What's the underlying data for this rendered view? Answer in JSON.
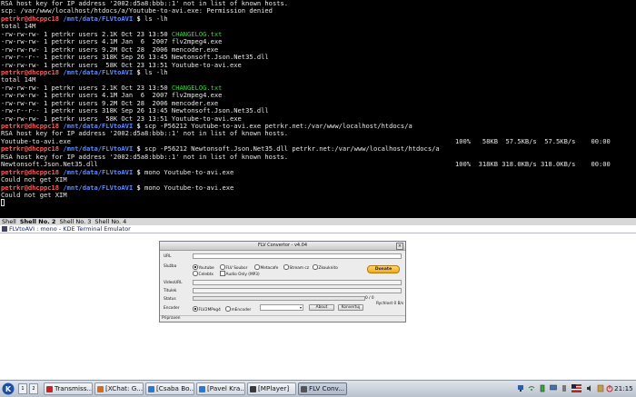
{
  "terminal": {
    "prompt": {
      "user": "petrkr@dhcppc18",
      "sign": "$"
    },
    "lines": [
      {
        "kind": "text",
        "text": "RSA host key for IP address '2002:d5a8:bbb::1' not in list of known hosts."
      },
      {
        "kind": "text",
        "text": "scp: /var/www/localhost/htdocs/a/Youtube-to-avi.exe: Permission denied"
      },
      {
        "kind": "prompt",
        "path": "/mnt/data/FLVtoAVI",
        "cmd": " ls -lh"
      },
      {
        "kind": "text",
        "text": "total 14M"
      },
      {
        "kind": "file",
        "meta": "-rw-rw-rw- 1 petrkr users 2.1K Oct 23 13:50 ",
        "name": "CHANGELOG.txt",
        "green": true
      },
      {
        "kind": "file",
        "meta": "-rw-rw-rw- 1 petrkr users 4.1M Jan  6  2007 ",
        "name": "flv2mpeg4.exe",
        "green": false
      },
      {
        "kind": "file",
        "meta": "-rw-rw-rw- 1 petrkr users 9.2M Oct 28  2006 ",
        "name": "mencoder.exe",
        "green": false
      },
      {
        "kind": "file",
        "meta": "-rw-r--r-- 1 petrkr users 318K Sep 26 13:45 ",
        "name": "Newtonsoft.Json.Net35.dll",
        "green": false
      },
      {
        "kind": "file",
        "meta": "-rw-rw-rw- 1 petrkr users  58K Oct 23 13:51 ",
        "name": "Youtube-to-avi.exe",
        "green": false
      },
      {
        "kind": "prompt",
        "path": "/mnt/data/FLVtoAVI",
        "cmd": " ls -lh"
      },
      {
        "kind": "text",
        "text": "total 14M"
      },
      {
        "kind": "file",
        "meta": "-rw-rw-rw- 1 petrkr users 2.1K Oct 23 13:50 ",
        "name": "CHANGELOG.txt",
        "green": true
      },
      {
        "kind": "file",
        "meta": "-rw-rw-rw- 1 petrkr users 4.1M Jan  6  2007 ",
        "name": "flv2mpeg4.exe",
        "green": false
      },
      {
        "kind": "file",
        "meta": "-rw-rw-rw- 1 petrkr users 9.2M Oct 28  2006 ",
        "name": "mencoder.exe",
        "green": false
      },
      {
        "kind": "file",
        "meta": "-rw-r--r-- 1 petrkr users 318K Sep 26 13:45 ",
        "name": "Newtonsoft.Json.Net35.dll",
        "green": false
      },
      {
        "kind": "file",
        "meta": "-rw-rw-rw- 1 petrkr users  58K Oct 23 13:51 ",
        "name": "Youtube-to-avi.exe",
        "green": false
      },
      {
        "kind": "prompt",
        "path": "/mnt/data/FLVtoAVI",
        "cmd": " scp -P56212 Youtube-to-avi.exe petrkr.net:/var/www/localhost/htdocs/a"
      },
      {
        "kind": "text",
        "text": "RSA host key for IP address '2002:d5a8:bbb::1' not in list of known hosts."
      },
      {
        "kind": "transfer",
        "text": "Youtube-to-avi.exe",
        "stat": "100%   58KB  57.5KB/s  57.5KB/s    00:00"
      },
      {
        "kind": "prompt",
        "path": "/mnt/data/FLVtoAVI",
        "cmd": " scp -P56212 Newtonsoft.Json.Net35.dll petrkr.net:/var/www/localhost/htdocs/a"
      },
      {
        "kind": "text",
        "text": "RSA host key for IP address '2002:d5a8:bbb::1' not in list of known hosts."
      },
      {
        "kind": "transfer",
        "text": "Newtonsoft.Json.Net35.dll",
        "stat": "100%  318KB 318.0KB/s 318.0KB/s    00:00"
      },
      {
        "kind": "prompt",
        "path": "/mnt/data/FLVtoAVI",
        "cmd": " mono Youtube-to-avi.exe"
      },
      {
        "kind": "text",
        "text": "Could not get XIM"
      },
      {
        "kind": "prompt",
        "path": "/mnt/data/FLVtoAVI",
        "cmd": " mono Youtube-to-avi.exe"
      },
      {
        "kind": "text",
        "text": "Could not get XIM"
      },
      {
        "kind": "cursor",
        "text": ""
      }
    ],
    "shell_tabs": [
      "Shell",
      "Shell No. 2",
      "Shell No. 3",
      "Shell No. 4"
    ],
    "window_title": "FLVtoAVI : mono - KDE Terminal Emulator"
  },
  "flv": {
    "title": "FLV Convertor - v4.04",
    "url_label": "URL",
    "url_value": "",
    "site_label": "Služba",
    "sites": [
      "Youtube",
      "FLV Soubor",
      "Metacafe",
      "Stream cz",
      "Zkouknito",
      "Celebtx",
      "Audio Only (MP3)"
    ],
    "selected_site": "Youtube",
    "donate_label": "Donate",
    "videourl_label": "VideoURL",
    "title_label": "Titulek",
    "status_label": "Status",
    "progress_text": "0 / 0",
    "speed_text": "Rychlost 0 B/s",
    "encoder_label": "Encoder",
    "encoders": [
      "FLV2MPeg4",
      "mEncoder"
    ],
    "selected_encoder": "FLV2MPeg4",
    "about_label": "About",
    "convert_label": "Konvertuj",
    "status_bar": "Pripraven"
  },
  "taskbar": {
    "desktops": [
      "1",
      "2"
    ],
    "tasks": [
      {
        "label": "Transmiss...",
        "icon_color": "#cc2222"
      },
      {
        "label": "[XChat: G...",
        "icon_color": "#d86a1a"
      },
      {
        "label": "[Csaba Bo...",
        "icon_color": "#2a7bd0"
      },
      {
        "label": "[Pavel Kra...",
        "icon_color": "#2a7bd0"
      },
      {
        "label": "[MPlayer]",
        "icon_color": "#3a3a3a"
      },
      {
        "label": "FLV Conv...",
        "icon_color": "#555555"
      }
    ],
    "active_task": 5,
    "clock": "21:15"
  },
  "colors": {
    "prompt_user": "#ff5c5c",
    "prompt_path": "#5c8cff",
    "file_green": "#3cd43c",
    "donate": "#f2a91a"
  }
}
